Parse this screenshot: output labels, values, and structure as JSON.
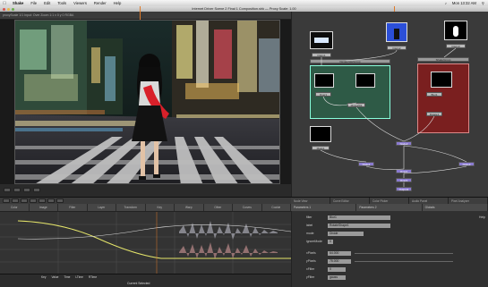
{
  "menubar": {
    "apple": "",
    "app": "Shake",
    "items": [
      "File",
      "Edit",
      "Tools",
      "Viewers",
      "Render",
      "Help"
    ],
    "clock": "Mon 13:32 AM"
  },
  "window": {
    "title": "Internet Driver Scene 2 Final 1 Composition.shk — Proxy Scale: 1.00"
  },
  "viewer": {
    "info": "proxyScale 1/1 Input: Over   Zoom 1:1   x 0  y 0  RGBA",
    "icon_names": [
      "play-icon",
      "stop-icon",
      "compare-icon",
      "zoom-icon"
    ]
  },
  "nodetree": {
    "groups": [
      {
        "label": "DesaturateGroup",
        "color": "#2e5a46"
      },
      {
        "label": "ShakeGroup",
        "color": "#7a1f1f"
      }
    ],
    "nodes": [
      "FileIn1",
      "FileIn2",
      "FileIn3",
      "Over1",
      "Move2D1",
      "Blur1",
      "Rotate1",
      "Mask1",
      "Node1",
      "Node2",
      "Node3",
      "Over2",
      "Over3",
      "Output1"
    ]
  },
  "timeline": {
    "tabs": [
      "Color",
      "Image",
      "Filter",
      "Layer",
      "Transform",
      "Key",
      "Warp",
      "Other",
      "Curves",
      "Cookie"
    ]
  },
  "curve_editor": {
    "tabs": [
      "Curve",
      "Keys",
      "Value",
      "Interp",
      "Time",
      "Curve Editor",
      "Audio Panel",
      "Color Picker"
    ],
    "labels": [
      "Key",
      "Value",
      "Time",
      "LTime",
      "RTime"
    ],
    "current_label": "Current Selected"
  },
  "params": {
    "tabs": [
      "Node View",
      "Curve Editor",
      "Color Picker",
      "Audio Panel",
      "Pixel Analyzer"
    ],
    "subtabs": [
      "Parameters 1",
      "Parameters 2",
      "Globals"
    ],
    "rows": [
      {
        "label": "filter",
        "value": "Blur1"
      },
      {
        "label": "label",
        "value": "RotateShape1"
      },
      {
        "label": "mode",
        "value": "Divide"
      },
      {
        "label": "ignoreMode",
        "value": "0"
      },
      {
        "label": "xPixels",
        "value": "64.000"
      },
      {
        "label": "yPixels",
        "value": "75.000"
      },
      {
        "label": "xFilter",
        "value": "0"
      },
      {
        "label": "yFilter",
        "value": "gauss"
      }
    ],
    "help_label": "Help"
  },
  "colors": {
    "accent": "#e07a28",
    "curve_yellow": "#e5e56a",
    "curve_pink": "#e0a0a0"
  }
}
